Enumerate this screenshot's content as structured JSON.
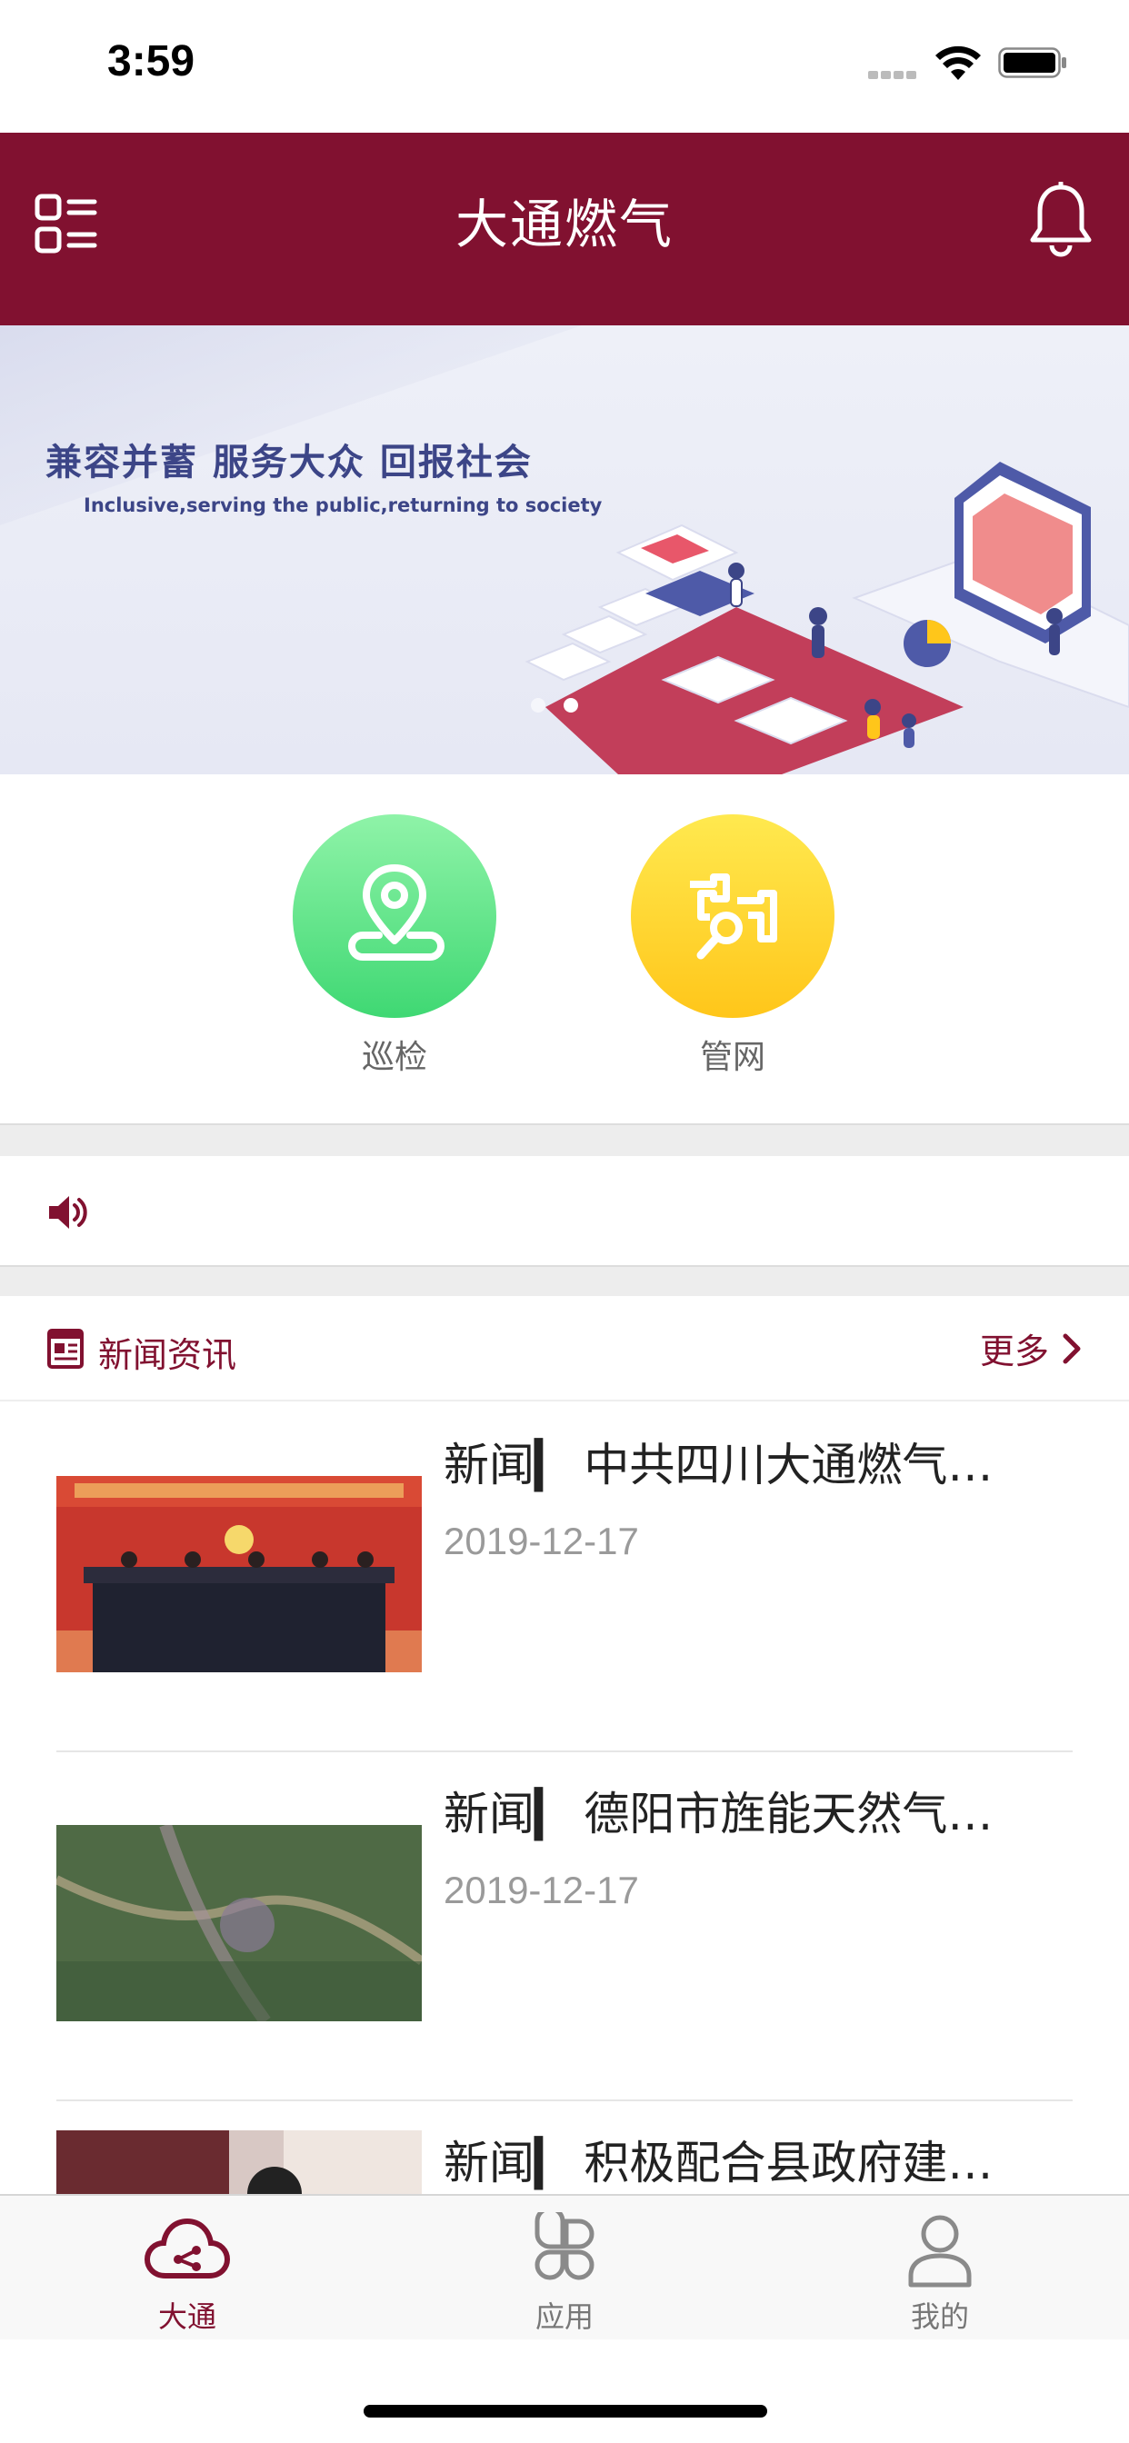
{
  "status_bar": {
    "time": "3:59"
  },
  "header": {
    "title": "大通燃气",
    "menu_icon": "grid-list-icon",
    "bell_icon": "bell-icon",
    "brand_color": "#811130"
  },
  "banner": {
    "slogan": "兼容并蓄 服务大众 回报社会",
    "slogan_en": "Inclusive,serving the public,returning to society",
    "page_count": 2,
    "active_page": 2
  },
  "quick_actions": [
    {
      "label": "巡检",
      "icon": "location-route-icon",
      "color": "#3fd873"
    },
    {
      "label": "管网",
      "icon": "pipe-network-icon",
      "color": "#ffc61a"
    }
  ],
  "notice": {
    "icon": "speaker-icon",
    "text": ""
  },
  "news_section": {
    "title": "新闻资讯",
    "more_label": "更多",
    "items": [
      {
        "headline": "新闻｜  中共四川大通燃气开发股份有限公司召开会议",
        "display": "新闻▎ 中共四川大通燃气…",
        "date": "2019-12-17"
      },
      {
        "headline": "新闻｜  德阳市旌能天然气有限公司",
        "display": "新闻▎ 德阳市旌能天然气…",
        "date": "2019-12-17"
      },
      {
        "headline": "新闻｜  积极配合县政府建设",
        "display": "新闻▎ 积极配合县政府建…",
        "date": ""
      }
    ]
  },
  "tab_bar": [
    {
      "label": "大通",
      "icon": "cloud-share-icon",
      "active": true
    },
    {
      "label": "应用",
      "icon": "apps-icon",
      "active": false
    },
    {
      "label": "我的",
      "icon": "user-icon",
      "active": false
    }
  ]
}
